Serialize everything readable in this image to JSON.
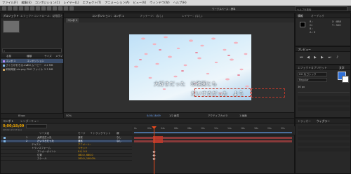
{
  "menubar": [
    "ファイル(F)",
    "編集(E)",
    "コンポジション(C)",
    "レイヤー(L)",
    "エフェクト(T)",
    "アニメーション(A)",
    "ビュー(V)",
    "ウィンドウ(W)",
    "ヘルプ(H)"
  ],
  "toolbar": {
    "workspace": "ワークスペース：標準",
    "help_search": "ヘルプを検索"
  },
  "project_panel": {
    "tabs": [
      "プロジェクト",
      "エフェクトコントロール：幼稚園とも"
    ],
    "search_placeholder": "",
    "columns": [
      "名前",
      "種類",
      "サイズ",
      "メディアの"
    ],
    "items": [
      {
        "name": "コンポ 1",
        "type": "コンポジション",
        "size": ""
      },
      {
        "name": "さくらがおちる.avi",
        "type": "AVI ムービー",
        "size": "2.2 MB"
      },
      {
        "name": "和柄背景 ois.png",
        "type": "PNG ファイル",
        "size": "2.3 MB"
      }
    ],
    "bpc": "8 bpc"
  },
  "comp_panel": {
    "tabs": [
      "コンポジション：コンポ 1",
      "フッテージ：(なし)",
      "レイヤー：(なし)"
    ],
    "breadcrumb": "コンポ 1",
    "subtitle_line1": "大好きだった　幼稚園とも",
    "subtitle_line2": "だいすきだった　よう",
    "zoom": "50%",
    "timecode": "0;00;18;09",
    "resolution": "1/2 画質",
    "camera": "アクティブカメラ",
    "views": "1 画面"
  },
  "info_panel": {
    "tabs": [
      "情報",
      "オーディオ"
    ],
    "values": {
      "r": "R :",
      "g": "G :",
      "b": "B :",
      "a": "A : 0",
      "x": "X : 888",
      "y": "Y : 520"
    }
  },
  "preview_panel": {
    "tabs": [
      "プレビュー"
    ]
  },
  "effects_panel": {
    "tabs": [
      "エフェクト＆プリセット",
      "文字"
    ],
    "font": "HG 丸ゴシック",
    "style": "Regular",
    "size": "36 px"
  },
  "timeline": {
    "tabs": [
      "コンポ 1",
      "レンダーキュー"
    ],
    "timecode": "0;00;18;09",
    "fps": "00549 (29.97 fps)",
    "columns": [
      "ソース名",
      "モード",
      "T トラックマット",
      "親"
    ],
    "layers": [
      {
        "num": "1",
        "name": "大好きだった",
        "mode": "通常",
        "parent": "なし"
      },
      {
        "num": "2",
        "name": "だいすきだった",
        "mode": "通常",
        "parent": "なし"
      },
      {
        "num": "",
        "name": "テキスト",
        "mode": "アニメート：",
        "parent": ""
      },
      {
        "num": "",
        "name": "トランスフォーム",
        "mode": "リセット",
        "parent": ""
      },
      {
        "num": "",
        "name": "アンカーポイント",
        "mode": "0.0, 0.0",
        "parent": ""
      },
      {
        "num": "",
        "name": "位置",
        "mode": "380.0, 680.0",
        "parent": ""
      },
      {
        "num": "",
        "name": "スケール",
        "mode": "100.0, 100.0%",
        "parent": ""
      }
    ],
    "ruler": [
      "0s",
      "02s",
      "04s",
      "06s",
      "08s",
      "10s",
      "12s",
      "14s",
      "16s",
      "18s",
      "20s",
      "22s"
    ],
    "colors": {
      "playhead": "#e8491d",
      "timecode": "#e6a000",
      "bar": "#5a9bcf",
      "selection": "#c0392b"
    }
  },
  "tracker_panel": {
    "tabs": [
      "トラッカー",
      "ウィグラー"
    ]
  }
}
